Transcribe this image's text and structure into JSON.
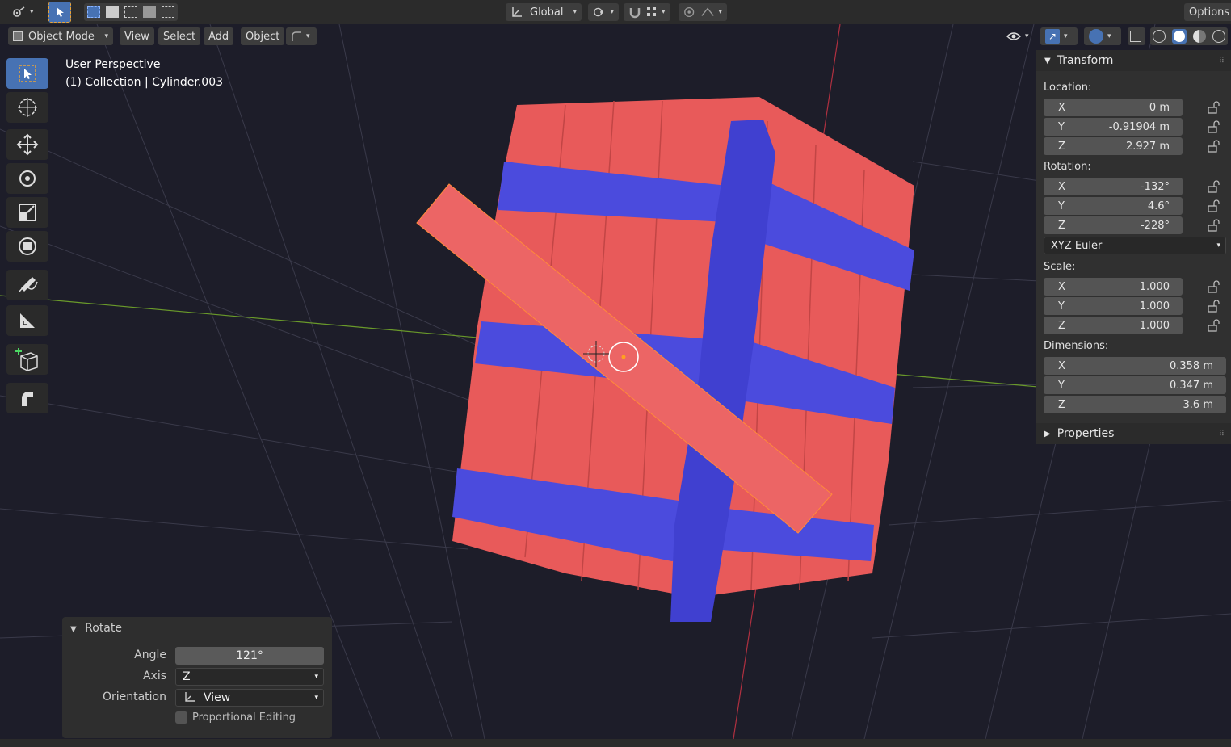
{
  "header": {
    "orientation_label": "Global",
    "options_label": "Options",
    "mode_label": "Object Mode",
    "menus": [
      "View",
      "Select",
      "Add",
      "Object"
    ]
  },
  "viewport": {
    "view_name": "User Perspective",
    "collection_info": "(1) Collection | Cylinder.003"
  },
  "transform": {
    "title": "Transform",
    "location_label": "Location:",
    "location": [
      {
        "axis": "X",
        "value": "0 m"
      },
      {
        "axis": "Y",
        "value": "-0.91904 m"
      },
      {
        "axis": "Z",
        "value": "2.927 m"
      }
    ],
    "rotation_label": "Rotation:",
    "rotation": [
      {
        "axis": "X",
        "value": "-132°"
      },
      {
        "axis": "Y",
        "value": "4.6°"
      },
      {
        "axis": "Z",
        "value": "-228°"
      }
    ],
    "rotation_mode": "XYZ Euler",
    "scale_label": "Scale:",
    "scale": [
      {
        "axis": "X",
        "value": "1.000"
      },
      {
        "axis": "Y",
        "value": "1.000"
      },
      {
        "axis": "Z",
        "value": "1.000"
      }
    ],
    "dimensions_label": "Dimensions:",
    "dimensions": [
      {
        "axis": "X",
        "value": "0.358 m"
      },
      {
        "axis": "Y",
        "value": "0.347 m"
      },
      {
        "axis": "Z",
        "value": "3.6 m"
      }
    ]
  },
  "properties_panel": {
    "title": "Properties"
  },
  "rotate_operator": {
    "title": "Rotate",
    "angle_label": "Angle",
    "angle_value": "121°",
    "axis_label": "Axis",
    "axis_value": "Z",
    "orientation_label": "Orientation",
    "orientation_value": "View",
    "proportional_label": "Proportional Editing"
  },
  "colors": {
    "accent": "#4772b3",
    "barrel_red": "#e85555",
    "band_blue": "#4b4bdd"
  },
  "icons": [
    "editor-type-icon",
    "select-box-icon",
    "cursor-icon",
    "move-icon",
    "rotate-icon",
    "scale-icon",
    "transform-icon",
    "annotate-icon",
    "measure-icon",
    "add-cube-icon",
    "spin-icon",
    "lock-icon",
    "overlay-icon",
    "shading-icon"
  ]
}
